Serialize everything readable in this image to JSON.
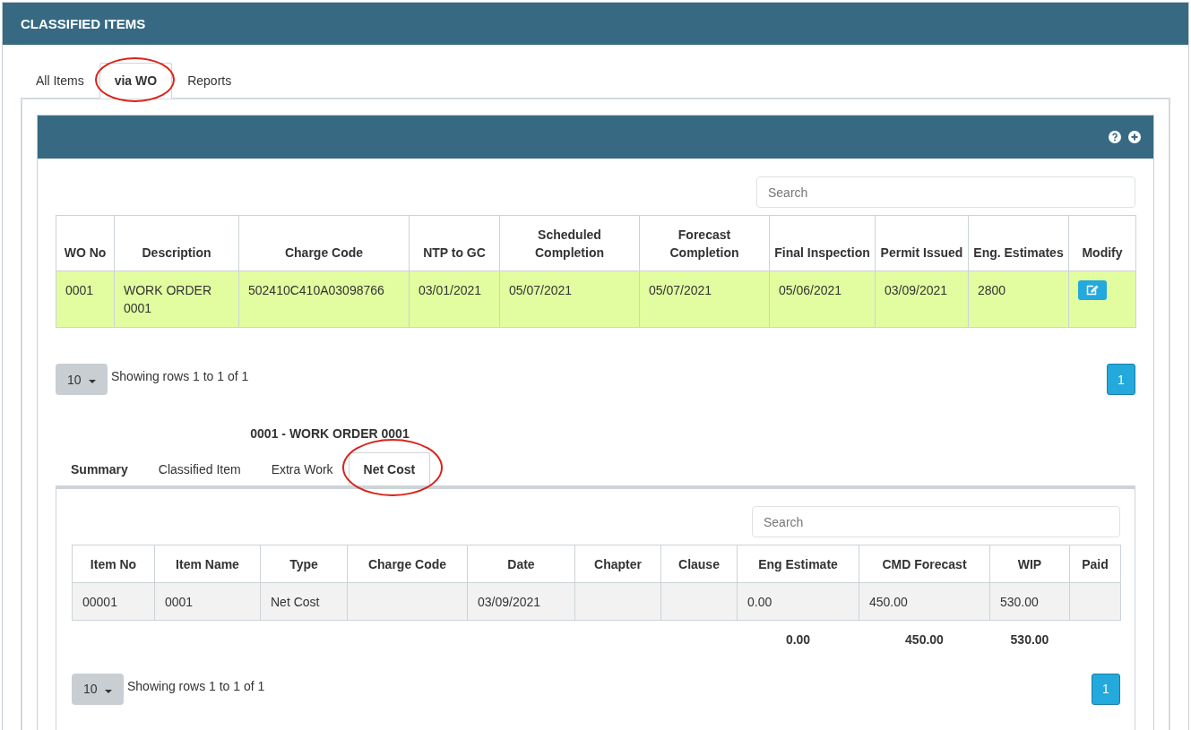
{
  "page_title": "CLASSIFIED ITEMS",
  "tabs": [
    {
      "label": "All Items",
      "selected": false,
      "circled": false
    },
    {
      "label": "via WO",
      "selected": true,
      "circled": true
    },
    {
      "label": "Reports",
      "selected": false,
      "circled": false
    }
  ],
  "work_orders": {
    "search": {
      "placeholder": "Search"
    },
    "columns": [
      "WO No",
      "Description",
      "Charge Code",
      "NTP to GC",
      "Scheduled Completion",
      "Forecast Completion",
      "Final Inspection",
      "Permit Issued",
      "Eng. Estimates",
      "Modify"
    ],
    "rows": [
      {
        "selected": true,
        "cells": [
          "0001",
          "WORK ORDER 0001",
          "502410C410A03098766",
          "03/01/2021",
          "05/07/2021",
          "05/07/2021",
          "05/06/2021",
          "03/09/2021",
          "2800"
        ]
      }
    ],
    "page_size": "10",
    "info": "Showing rows 1 to 1 of 1",
    "pages": [
      {
        "label": "1",
        "selected": true
      }
    ]
  },
  "detail": {
    "title": "0001 - WORK ORDER 0001",
    "tabs": [
      {
        "label": "Summary",
        "selected": false,
        "bold": true,
        "circled": false
      },
      {
        "label": "Classified Item",
        "selected": false,
        "bold": false,
        "circled": false
      },
      {
        "label": "Extra Work",
        "selected": false,
        "bold": false,
        "circled": false
      },
      {
        "label": "Net Cost",
        "selected": true,
        "bold": true,
        "circled": true
      }
    ],
    "search": {
      "placeholder": "Search"
    },
    "columns": [
      "Item No",
      "Item Name",
      "Type",
      "Charge Code",
      "Date",
      "Chapter",
      "Clause",
      "Eng Estimate",
      "CMD Forecast",
      "WIP",
      "Paid"
    ],
    "rows": [
      {
        "selected": false,
        "cells": [
          "00001",
          "0001",
          "Net Cost",
          null,
          "03/09/2021",
          null,
          null,
          "0.00",
          "450.00",
          "530.00",
          null
        ]
      }
    ],
    "totals": {
      "eng_estimate": "0.00",
      "cmd_forecast": "450.00",
      "wip": "530.00"
    },
    "page_size": "10",
    "info": "Showing rows 1 to 1 of 1",
    "pages": [
      {
        "label": "1",
        "selected": true
      }
    ]
  }
}
